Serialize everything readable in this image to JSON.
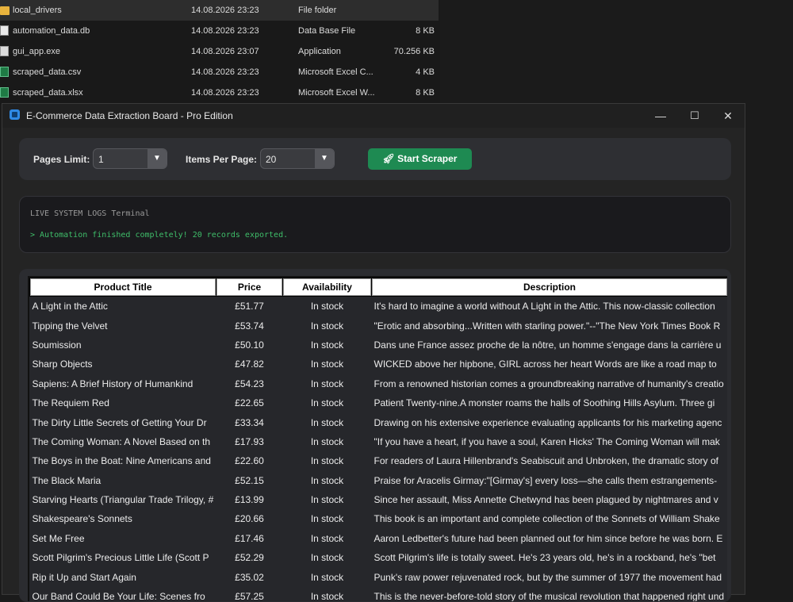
{
  "explorer": {
    "files": [
      {
        "name": "local_drivers",
        "date": "14.08.2026 23:23",
        "type": "File folder",
        "size": "",
        "icon": "folder-icon",
        "selected": true
      },
      {
        "name": "automation_data.db",
        "date": "14.08.2026 23:23",
        "type": "Data Base File",
        "size": "8 KB",
        "icon": "database-file-icon"
      },
      {
        "name": "gui_app.exe",
        "date": "14.08.2026 23:07",
        "type": "Application",
        "size": "70.256 KB",
        "icon": "application-file-icon"
      },
      {
        "name": "scraped_data.csv",
        "date": "14.08.2026 23:23",
        "type": "Microsoft Excel C...",
        "size": "4 KB",
        "icon": "excel-file-icon"
      },
      {
        "name": "scraped_data.xlsx",
        "date": "14.08.2026 23:23",
        "type": "Microsoft Excel W...",
        "size": "8 KB",
        "icon": "excel-file-icon"
      }
    ]
  },
  "window": {
    "title": "E-Commerce Data Extraction Board - Pro Edition",
    "minimize": "—",
    "maximize": "☐",
    "close": "✕"
  },
  "controls": {
    "pages_label": "Pages Limit:",
    "pages_value": "1",
    "items_label": "Items Per Page:",
    "items_value": "20",
    "start_label": "Start Scraper",
    "start_icon": "rocket-icon",
    "accent": "#1e8a52"
  },
  "logs": {
    "title": "LIVE SYSTEM LOGS Terminal",
    "line": "> Automation finished completely! 20 records exported."
  },
  "table": {
    "headers": [
      "Product Title",
      "Price",
      "Availability",
      "Description"
    ],
    "rows": [
      [
        "A Light in the Attic",
        "£51.77",
        "In stock",
        "It's hard to imagine a world without A Light in the Attic. This now-classic collection"
      ],
      [
        "Tipping the Velvet",
        "£53.74",
        "In stock",
        "\"Erotic and absorbing...Written with starling power.\"--\"The New York Times Book R"
      ],
      [
        "Soumission",
        "£50.10",
        "In stock",
        "Dans une France assez proche de la nôtre, un homme s'engage dans la carrière u"
      ],
      [
        "Sharp Objects",
        "£47.82",
        "In stock",
        "WICKED above her hipbone, GIRL across her heart Words are like a road map to"
      ],
      [
        "Sapiens: A Brief History of Humankind",
        "£54.23",
        "In stock",
        "From a renowned historian comes a groundbreaking narrative of humanity's creatio"
      ],
      [
        "The Requiem Red",
        "£22.65",
        "In stock",
        "Patient Twenty-nine.A monster roams the halls of Soothing Hills Asylum. Three gi"
      ],
      [
        "The Dirty Little Secrets of Getting Your Dr",
        "£33.34",
        "In stock",
        "Drawing on his extensive experience evaluating applicants for his marketing agenc"
      ],
      [
        "The Coming Woman: A Novel Based on th",
        "£17.93",
        "In stock",
        "\"If you have a heart, if you have a soul, Karen Hicks' The Coming Woman will mak"
      ],
      [
        "The Boys in the Boat: Nine Americans and",
        "£22.60",
        "In stock",
        "For readers of Laura Hillenbrand's Seabiscuit and Unbroken, the dramatic story of"
      ],
      [
        "The Black Maria",
        "£52.15",
        "In stock",
        "Praise for Aracelis Girmay:\"[Girmay's] every loss—she calls them estrangements-"
      ],
      [
        "Starving Hearts (Triangular Trade Trilogy, #",
        "£13.99",
        "In stock",
        "Since her assault, Miss Annette Chetwynd has been plagued by nightmares and v"
      ],
      [
        "Shakespeare's Sonnets",
        "£20.66",
        "In stock",
        "This book is an important and complete collection of the Sonnets of William Shake"
      ],
      [
        "Set Me Free",
        "£17.46",
        "In stock",
        "Aaron Ledbetter's future had been planned out for him since before he was born. E"
      ],
      [
        "Scott Pilgrim's Precious Little Life (Scott P",
        "£52.29",
        "In stock",
        "Scott Pilgrim's life is totally sweet. He's 23 years old, he's in a rockband, he's \"bet"
      ],
      [
        "Rip it Up and Start Again",
        "£35.02",
        "In stock",
        "Punk's raw power rejuvenated rock, but by the summer of 1977 the movement had"
      ],
      [
        "Our Band Could Be Your Life: Scenes fro",
        "£57.25",
        "In stock",
        "This is the never-before-told story of the musical revolution that happened right und"
      ]
    ]
  }
}
